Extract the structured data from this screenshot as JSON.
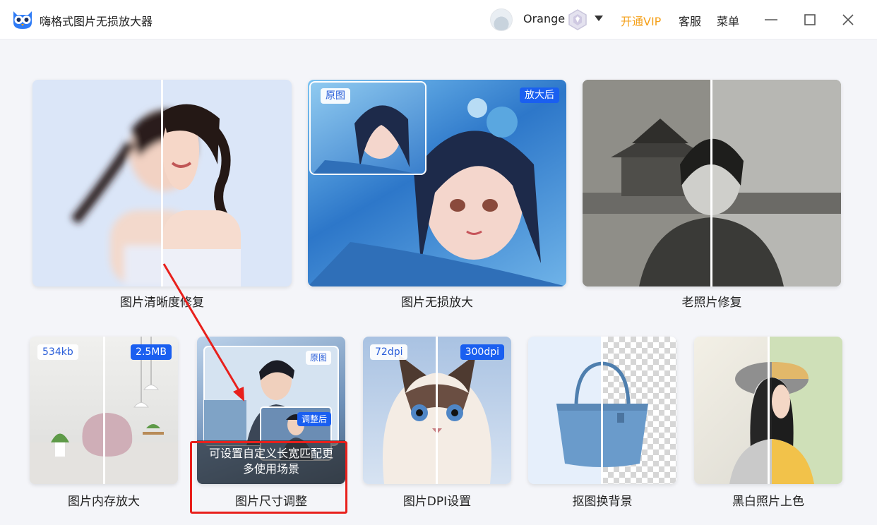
{
  "titlebar": {
    "app_title": "嗨格式图片无损放大器",
    "username": "Orange",
    "open_vip": "开通VIP",
    "service": "客服",
    "menu": "菜单"
  },
  "colors": {
    "vip": "#f5a11c",
    "tag_blue": "#1a5ff0",
    "highlight": "#e8201c"
  },
  "cards": {
    "sharpen": {
      "label": "图片清晰度修复"
    },
    "upscale": {
      "label": "图片无损放大",
      "tag_before": "原图",
      "tag_after": "放大后"
    },
    "old_photo": {
      "label": "老照片修复"
    },
    "memory": {
      "label": "图片内存放大",
      "tag_before": "534kb",
      "tag_after": "2.5MB"
    },
    "resize": {
      "label": "图片尺寸调整",
      "tag_before": "原图",
      "tag_after": "调整后",
      "tooltip": "可设置自定义长宽匹配更多使用场景"
    },
    "dpi": {
      "label": "图片DPI设置",
      "tag_before": "72dpi",
      "tag_after": "300dpi"
    },
    "cutout": {
      "label": "抠图换背景"
    },
    "colorize": {
      "label": "黑白照片上色"
    }
  },
  "icons": {
    "logo": "owl-logo-icon",
    "vip": "vip-diamond-icon",
    "dropdown": "chevron-down-icon",
    "minimize": "minimize-icon",
    "maximize": "maximize-icon",
    "close": "close-icon"
  }
}
